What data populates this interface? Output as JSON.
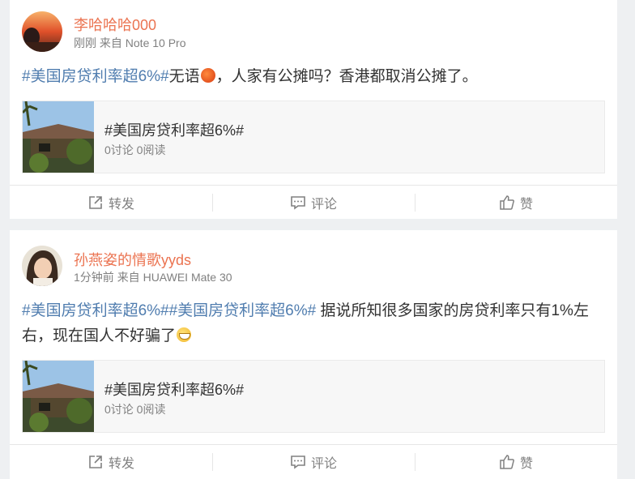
{
  "posts": [
    {
      "username": "李哈哈哈000",
      "time": "刚刚",
      "source_prefix": "来自",
      "device": "Note 10 Pro",
      "text_topic": "#美国房贷利率超6%#",
      "text_body_1": "无语",
      "emoji_1": "angry-emoji",
      "text_body_2": "，人家有公摊吗？香港都取消公摊了。",
      "topic_card": {
        "title": "#美国房贷利率超6%#",
        "stats": "0讨论 0阅读"
      }
    },
    {
      "username": "孙燕姿的情歌yyds",
      "time": "1分钟前",
      "source_prefix": "来自",
      "device": "HUAWEI Mate 30",
      "text_topic": "#美国房贷利率超6%##美国房贷利率超6%#",
      "text_body_1": " 据说所知很多国家的房贷利率只有1%左右，现在国人不好骗了",
      "emoji_1": "grin-emoji",
      "text_body_2": "",
      "topic_card": {
        "title": "#美国房贷利率超6%#",
        "stats": "0讨论 0阅读"
      }
    }
  ],
  "actions": {
    "repost": "转发",
    "comment": "评论",
    "like": "赞"
  },
  "colors": {
    "username": "#eb7350",
    "topic": "#507daf",
    "meta": "#808080"
  }
}
